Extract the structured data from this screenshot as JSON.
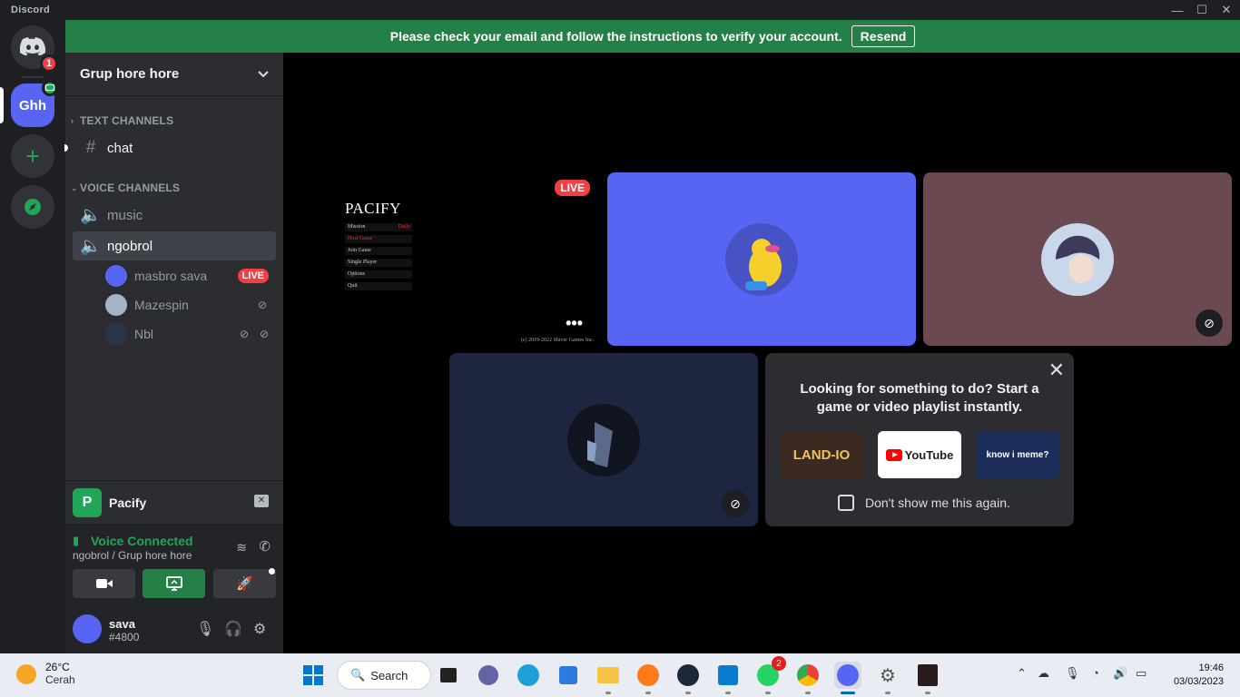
{
  "window": {
    "app_name": "Discord"
  },
  "banner": {
    "message": "Please check your email and follow the instructions to verify your account.",
    "resend_label": "Resend"
  },
  "rail": {
    "home_badge": "1",
    "guild_initials": "Ghh"
  },
  "guild": {
    "name": "Grup hore hore"
  },
  "categories": {
    "text": "TEXT CHANNELS",
    "voice": "VOICE CHANNELS"
  },
  "text_channels": [
    {
      "name": "chat"
    }
  ],
  "voice_channels": [
    {
      "name": "music"
    },
    {
      "name": "ngobrol"
    }
  ],
  "voice_users": [
    {
      "name": "masbro sava",
      "badge": "LIVE"
    },
    {
      "name": "Mazespin"
    },
    {
      "name": "Nbl"
    }
  ],
  "activity": {
    "icon_letter": "P",
    "name": "Pacify"
  },
  "voice_panel": {
    "status": "Voice Connected",
    "location": "ngobrol / Grup hore hore"
  },
  "user": {
    "name": "sava",
    "tag": "#4800"
  },
  "stage": {
    "stream": {
      "live_label": "LIVE",
      "game_title": "PACIFY",
      "menu": [
        "Mission",
        "Host Game",
        "Join Game",
        "Single Player",
        "Options",
        "Quit"
      ],
      "menu_extra": "Daily",
      "copyright": "(c) 2019-2022 Shiver Games Inc."
    },
    "suggestion": {
      "message": "Looking for something to do? Start a game or video playlist instantly.",
      "items": [
        "LAND-IO",
        "YouTube",
        "know i meme?"
      ],
      "dont_show": "Don't show me this again."
    }
  },
  "taskbar": {
    "weather_temp": "26°C",
    "weather_desc": "Cerah",
    "search_label": "Search",
    "whatsapp_badge": "2",
    "time": "19:46",
    "date": "03/03/2023"
  },
  "colors": {
    "blurple": "#5865f2",
    "green": "#23a559",
    "red": "#f23f43",
    "banner": "#248046"
  }
}
